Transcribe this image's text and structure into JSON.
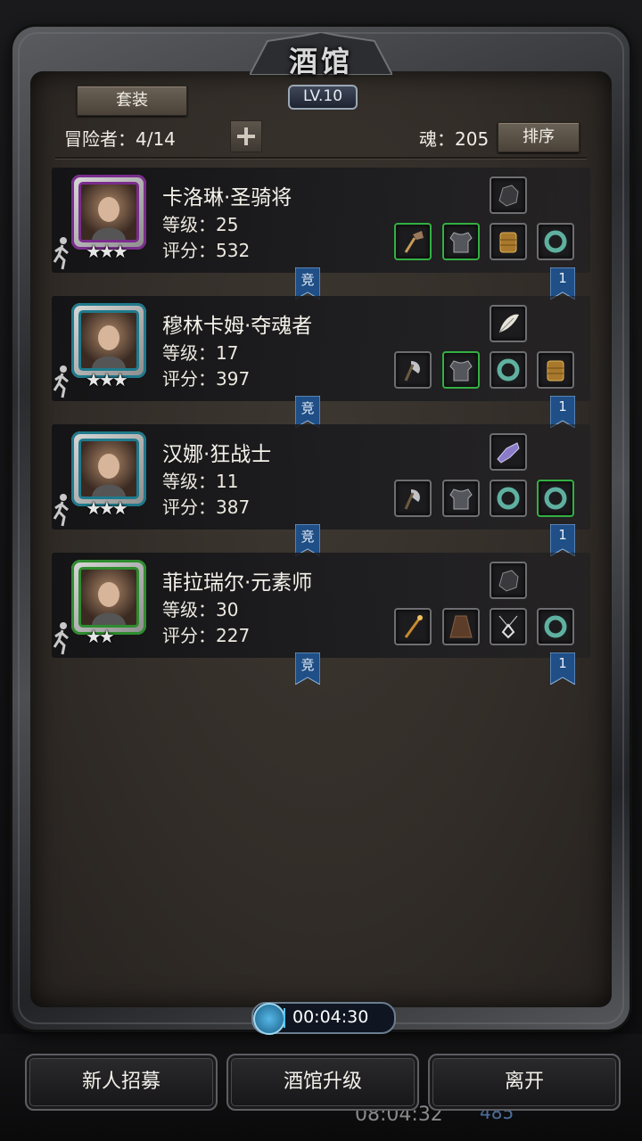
{
  "header": {
    "title": "酒馆",
    "level": "LV.10",
    "set_button": "套装",
    "adventurers": "冒险者：4/14",
    "soul": "魂：205",
    "sort_button": "排序"
  },
  "heroes": [
    {
      "name": "卡洛琳·圣骑将",
      "level": "等级：25",
      "score": "评分：532",
      "stars": "★★★",
      "portrait_color": "#7a2d8c",
      "top_item": "gauntlet-icon",
      "items": [
        {
          "icon": "hammer-icon",
          "rare": true
        },
        {
          "icon": "armor-icon",
          "rare": true
        },
        {
          "icon": "boots-icon",
          "rare": false
        },
        {
          "icon": "ring-icon",
          "rare": false
        }
      ],
      "arena_tag": "竞",
      "rank_tag": "1"
    },
    {
      "name": "穆林卡姆·夺魂者",
      "level": "等级：17",
      "score": "评分：397",
      "stars": "★★★",
      "portrait_color": "#1f7a8c",
      "top_item": "feather-icon",
      "items": [
        {
          "icon": "axe-icon",
          "rare": false
        },
        {
          "icon": "armor-icon",
          "rare": true
        },
        {
          "icon": "ring-icon",
          "rare": false
        },
        {
          "icon": "boots-icon",
          "rare": false
        }
      ],
      "arena_tag": "竞",
      "rank_tag": "1"
    },
    {
      "name": "汉娜·狂战士",
      "level": "等级：11",
      "score": "评分：387",
      "stars": "★★★",
      "portrait_color": "#1f7a8c",
      "top_item": "crystal-icon",
      "items": [
        {
          "icon": "axe-icon",
          "rare": false
        },
        {
          "icon": "armor-icon",
          "rare": false
        },
        {
          "icon": "ring-icon",
          "rare": false
        },
        {
          "icon": "ring-icon",
          "rare": true
        }
      ],
      "arena_tag": "竞",
      "rank_tag": "1"
    },
    {
      "name": "菲拉瑞尔·元素师",
      "level": "等级：30",
      "score": "评分：227",
      "stars": "★★",
      "portrait_color": "#2f8c2f",
      "top_item": "gauntlet-icon",
      "items": [
        {
          "icon": "staff-icon",
          "rare": false
        },
        {
          "icon": "robe-icon",
          "rare": false
        },
        {
          "icon": "amulet-icon",
          "rare": false
        },
        {
          "icon": "ring-icon",
          "rare": false
        }
      ],
      "arena_tag": "竞",
      "rank_tag": "1"
    }
  ],
  "timer": "00:04:30",
  "buttons": {
    "recruit": "新人招募",
    "upgrade": "酒馆升级",
    "leave": "离开"
  },
  "background": {
    "clock": "08:04:32",
    "gems": "485"
  }
}
